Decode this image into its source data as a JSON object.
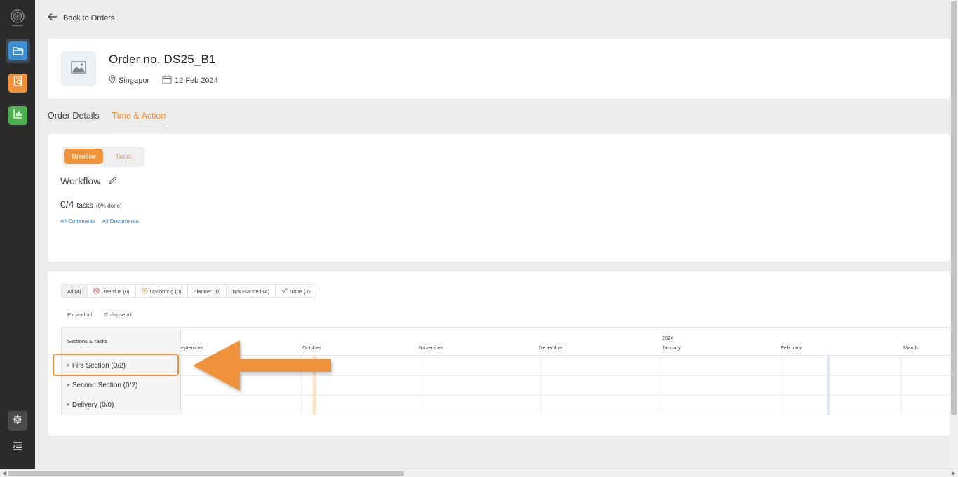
{
  "sidebar": {
    "items": [
      {
        "name": "folder-icon",
        "color": "#3a8fd6",
        "active": true
      },
      {
        "name": "document-search-icon",
        "color": "#f0923a"
      },
      {
        "name": "bar-chart-icon",
        "color": "#4caf50"
      }
    ],
    "bottom": [
      "gear-icon",
      "menu-icon"
    ]
  },
  "nav": {
    "back_label": "Back to Orders"
  },
  "order": {
    "title": "Order no. DS25_B1",
    "location": "Singapor",
    "date": "12 Feb 2024"
  },
  "tabs": [
    {
      "label": "Order Details",
      "active": false
    },
    {
      "label": "Time & Action",
      "active": true
    }
  ],
  "view_toggle": {
    "timeline": "Timeline",
    "tasks": "Tasks",
    "selected": "Timeline"
  },
  "workflow": {
    "title": "Workflow",
    "count": "0/4",
    "count_label": "tasks",
    "percent_label": "(0% done)",
    "links": [
      "All Comments",
      "All Documents"
    ]
  },
  "filters": [
    {
      "label": "All (4)",
      "icon": "",
      "selected": true
    },
    {
      "label": "Overdue (0)",
      "icon": "overdue-icon"
    },
    {
      "label": "Upcoming (0)",
      "icon": "upcoming-icon"
    },
    {
      "label": "Planned (0)",
      "icon": ""
    },
    {
      "label": "Not Planned (4)",
      "icon": ""
    },
    {
      "label": "Done (0)",
      "icon": "check-icon"
    }
  ],
  "expand_all": "Expand all",
  "collapse_all": "Collapse all",
  "gantt": {
    "header": "Sections & Tasks",
    "year": "2024",
    "months": [
      "eptember",
      "October",
      "November",
      "December",
      "January",
      "February",
      "March"
    ],
    "sections": [
      "Firs Section (0/2)",
      "Second Section (0/2)",
      "Delivery (0/0)"
    ],
    "highlighted_section": "Firs Section (0/2)"
  },
  "colors": {
    "accent": "#f0923a",
    "link": "#2d7fc1",
    "sidebar_bg": "#2b2b2b"
  }
}
